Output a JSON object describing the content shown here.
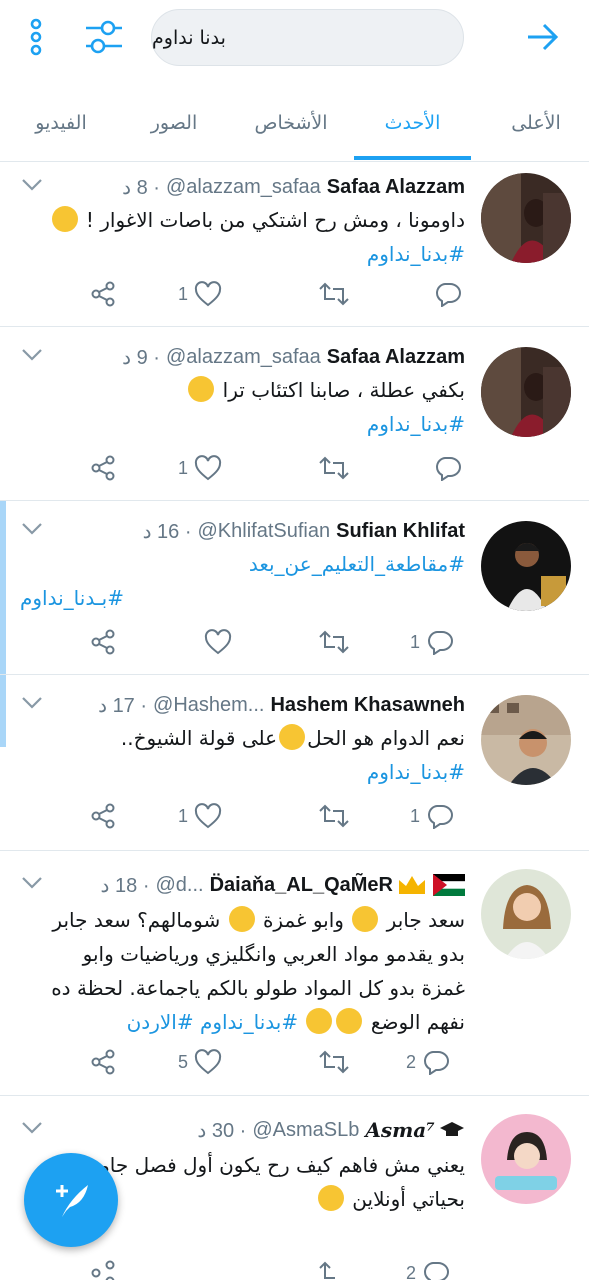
{
  "search": {
    "query": "بدنا نداوم"
  },
  "tabs": [
    {
      "label": "الأعلى",
      "active": false
    },
    {
      "label": "الأحدث",
      "active": true
    },
    {
      "label": "الأشخاص",
      "active": false
    },
    {
      "label": "الصور",
      "active": false
    },
    {
      "label": "الفيديو",
      "active": false
    }
  ],
  "tweets": [
    {
      "name": "Safaa Alazzam",
      "handle": "@alazzam_safaa",
      "time": "· 8 د",
      "lines": [
        "داومونا ، ومش رح اشتكي من باصات الاغوار !"
      ],
      "hashtags": "#بدنا_نداوم",
      "replies": "",
      "retweets": "",
      "likes": "1"
    },
    {
      "name": "Safaa Alazzam",
      "handle": "@alazzam_safaa",
      "time": "· 9 د",
      "lines": [
        "بكفي عطلة ، صابنا اكتئاب ترا"
      ],
      "hashtags": "#بدنا_نداوم",
      "replies": "",
      "retweets": "",
      "likes": "1"
    },
    {
      "name": "Sufian Khlifat",
      "handle": "@KhlifatSufian",
      "time": "· 16 د",
      "lines": [],
      "hashtags": "#مقاطعة_التعليم_عن_بعد",
      "hashtags2": "#بـدنا_نداوم",
      "replies": "1",
      "retweets": "",
      "likes": ""
    },
    {
      "name": "Hashem Khasawneh",
      "handle": "@Hashem...",
      "time": "· 17 د",
      "lines": [
        "نعم الدوام هو الحل",
        "على قولة الشيوخ.."
      ],
      "hashtags": "#بدنا_نداوم",
      "replies": "1",
      "retweets": "",
      "likes": "1"
    },
    {
      "name": "D̈aiaňa_AL_QaM̃eR",
      "handle": "@d...",
      "time": "· 18 د",
      "lines": [
        "سعد جابر",
        "وابو غمزة",
        "شومالهم؟ سعد جابر",
        "بدو يقدمو مواد العربي وانگليزي ورياضيات وابو",
        "غمزة بدو كل المواد طولو بالكم ياجماعة. لحظة ده",
        "نفهم الوضع"
      ],
      "hashtags": "#بدنا_نداوم #الاردن",
      "replies": "2",
      "retweets": "",
      "likes": "5"
    },
    {
      "name": "𝑨𝒔𝒎𝒂⁷",
      "handle": "@AsmaSLb",
      "time": "· 30 د",
      "lines": [
        "يعني مش فاهم كيف رح يكون أول فصل جامعي",
        "بحياتي أونلاين"
      ],
      "hashtags": "",
      "replies": "2",
      "retweets": "",
      "likes": ""
    }
  ],
  "colors": {
    "accent": "#1da1f2",
    "hashtag": "#1b95e0",
    "muted": "#657786",
    "thread": "#a9d6f8"
  },
  "icons": [
    "menu-dots-icon",
    "filter-icon",
    "back-arrow-icon",
    "caret-down-icon",
    "share-icon",
    "like-icon",
    "retweet-icon",
    "reply-icon",
    "compose-icon"
  ]
}
